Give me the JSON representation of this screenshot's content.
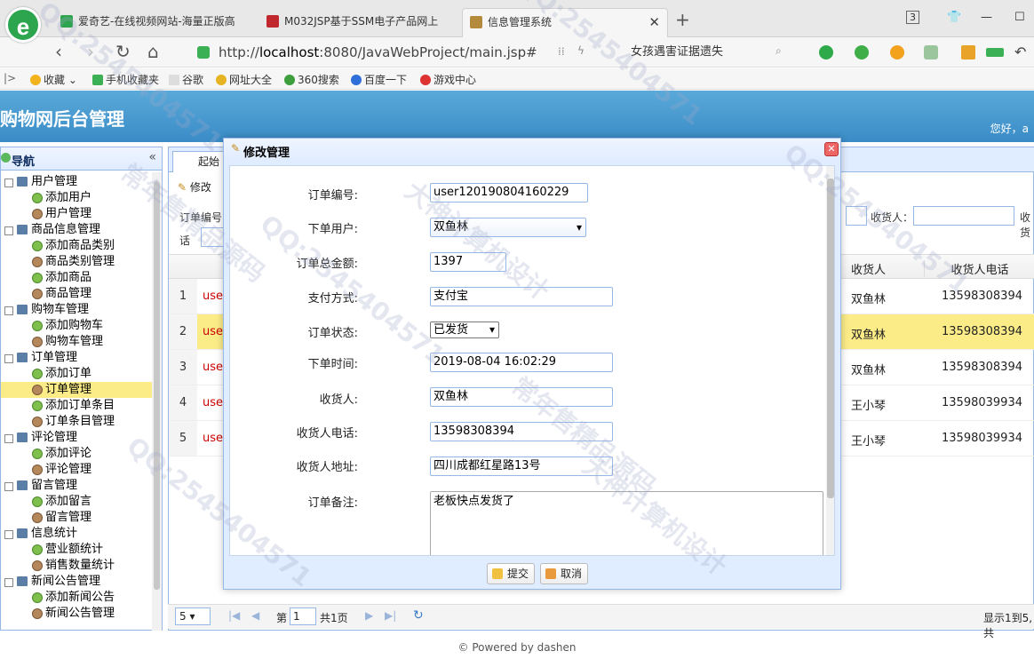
{
  "browser": {
    "tabs": [
      {
        "label": "爱奇艺-在线视频网站-海量正版高"
      },
      {
        "label": "M032JSP基于SSM电子产品网上"
      },
      {
        "label": "信息管理系统"
      }
    ],
    "tab_count": "3",
    "url_prefix": "http://",
    "url_host": "localhost",
    "url_rest": ":8080/JavaWebProject/main.jsp#",
    "search_text": "女孩遇害证据遗失",
    "bookmarks": [
      "收藏",
      "手机收藏夹",
      "谷歌",
      "网址大全",
      "360搜索",
      "百度一下",
      "游戏中心"
    ],
    "colors": {
      "accent": "#3a8cc7",
      "header": "#5aa9d9",
      "highlight": "#fbec88"
    }
  },
  "app": {
    "title": "购物网后台管理",
    "greeting": "您好，a"
  },
  "nav": {
    "title": "导航",
    "groups": [
      {
        "label": "用户管理",
        "items": [
          "添加用户",
          "用户管理"
        ]
      },
      {
        "label": "商品信息管理",
        "items": [
          "添加商品类别",
          "商品类别管理",
          "添加商品",
          "商品管理"
        ]
      },
      {
        "label": "购物车管理",
        "items": [
          "添加购物车",
          "购物车管理"
        ]
      },
      {
        "label": "订单管理",
        "items": [
          "添加订单",
          "订单管理",
          "添加订单条目",
          "订单条目管理"
        ]
      },
      {
        "label": "评论管理",
        "items": [
          "添加评论",
          "评论管理"
        ]
      },
      {
        "label": "留言管理",
        "items": [
          "添加留言",
          "留言管理"
        ]
      },
      {
        "label": "信息统计",
        "items": [
          "营业额统计",
          "销售数量统计"
        ]
      },
      {
        "label": "新闻公告管理",
        "items": [
          "添加新闻公告",
          "新闻公告管理"
        ]
      }
    ]
  },
  "main": {
    "tab": "起始",
    "toolbar_edit": "修改",
    "search_label_1": "订单编号",
    "search_label_2": "话",
    "search_label_3": "收货人：",
    "search_label_4": "收货",
    "columns": [
      "收货人",
      "收货人电话"
    ],
    "rows": [
      {
        "num": "1",
        "prefix": "user",
        "receiver": "双鱼林",
        "phone": "13598308394"
      },
      {
        "num": "2",
        "prefix": "user",
        "receiver": "双鱼林",
        "phone": "13598308394"
      },
      {
        "num": "3",
        "prefix": "user",
        "receiver": "双鱼林",
        "phone": "13598308394"
      },
      {
        "num": "4",
        "prefix": "user",
        "receiver": "王小琴",
        "phone": "13598039934"
      },
      {
        "num": "5",
        "prefix": "user",
        "receiver": "王小琴",
        "phone": "13598039934"
      }
    ]
  },
  "pager": {
    "page_size": "5",
    "page_prefix": "第",
    "page_value": "1",
    "page_total": "共1页",
    "summary": "显示1到5,共"
  },
  "footer": "© Powered by dashen",
  "dialog": {
    "title": "修改管理",
    "fields": {
      "order_no_label": "订单编号:",
      "order_no": "user120190804160229",
      "user_label": "下单用户:",
      "user": "双鱼林",
      "total_label": "订单总金额:",
      "total": "1397",
      "pay_label": "支付方式:",
      "pay": "支付宝",
      "status_label": "订单状态:",
      "status": "已发货",
      "time_label": "下单时间:",
      "time": "2019-08-04 16:02:29",
      "receiver_label": "收货人:",
      "receiver": "双鱼林",
      "phone_label": "收货人电话:",
      "phone": "13598308394",
      "address_label": "收货人地址:",
      "address": "四川成都红星路13号",
      "memo_label": "订单备注:",
      "memo": "老板快点发货了"
    },
    "submit": "提交",
    "cancel": "取消"
  },
  "watermarks": [
    "QQ:2545404571",
    "大神计算机设计",
    "常年售精品源码"
  ]
}
